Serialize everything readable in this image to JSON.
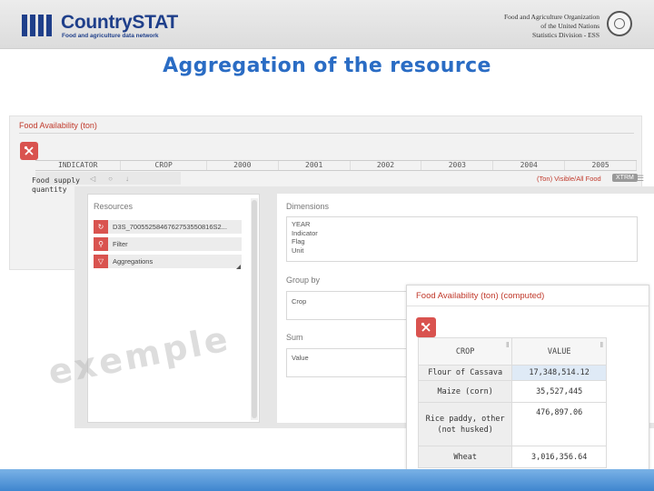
{
  "header": {
    "brand_name": "CountrySTAT",
    "brand_tagline": "Food and agriculture data network",
    "org_lines": [
      "Food and Agriculture Organization",
      "of the United Nations",
      "Statistics Division - ESS"
    ]
  },
  "slide_title": "Aggregation of the resource",
  "grid_panel": {
    "title": "Food Availability (ton)",
    "columns": [
      "INDICATOR",
      "CROP",
      "2000",
      "2001",
      "2002",
      "2003",
      "2004",
      "2005"
    ],
    "controls": [
      "◁",
      "○",
      "↓"
    ],
    "first_cell_lines": [
      "Food supply",
      "quantity"
    ],
    "right_note": "(Ton) Visible/All Food",
    "badge": "XTRM",
    "menu": "☰"
  },
  "resources_panel": {
    "title": "Resources",
    "items": [
      {
        "label": "D3S_7005525846762753550816S2...",
        "icon": "↻"
      },
      {
        "label": "Filter",
        "icon": "⚲"
      },
      {
        "label": "Aggregations",
        "icon": "▽"
      }
    ]
  },
  "dimensions_panel": {
    "title": "Dimensions",
    "items": [
      "YEAR",
      "Indicator",
      "Flag",
      "Unit"
    ],
    "groupby_title": "Group by",
    "groupby_value": "Crop",
    "sum_title": "Sum",
    "sum_value": "Value"
  },
  "watermark": "exemple",
  "computed_panel": {
    "title": "Food Availability (ton) (computed)",
    "columns": [
      "CROP",
      "VALUE"
    ],
    "rows": [
      {
        "crop": "Flour of Cassava",
        "value": "17,348,514.12",
        "highlight": true
      },
      {
        "crop": "Maize (corn)",
        "value": "35,527,445",
        "highlight": false
      },
      {
        "crop": "Rice paddy, other (not husked)",
        "value": "476,897.06",
        "highlight": false
      },
      {
        "crop": "Wheat",
        "value": "3,016,356.64",
        "highlight": false
      }
    ]
  },
  "colors": {
    "brand_blue": "#1f3f8a",
    "title_blue": "#2a6cc4",
    "accent_red": "#d9534f",
    "footer_blue": "#3f86cf"
  }
}
